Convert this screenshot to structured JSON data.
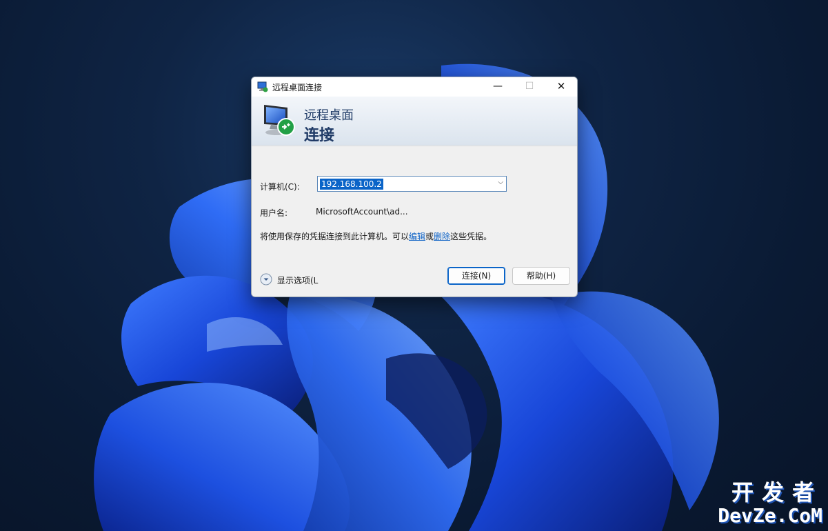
{
  "window": {
    "title": "远程桌面连接",
    "minimize_glyph": "—",
    "maximize_glyph": "☐",
    "close_glyph": "✕"
  },
  "banner": {
    "line1": "远程桌面",
    "line2": "连接"
  },
  "form": {
    "computer_label": "计算机(C):",
    "computer_value": "192.168.100.2",
    "username_label": "用户名:",
    "username_value": "MicrosoftAccount\\ad...",
    "info_prefix": "将使用保存的凭据连接到此计算机。可以",
    "info_edit_link": "编辑",
    "info_or": "或",
    "info_delete_link": "删除",
    "info_suffix": "这些凭据。"
  },
  "footer": {
    "show_options_label": "显示选项(L",
    "connect_button": "连接(N)",
    "help_button": "帮助(H)"
  },
  "watermark": {
    "cn": "开发者",
    "en": "DevZe.CoM"
  },
  "colors": {
    "accent": "#0a64c8",
    "banner_text": "#1f3a66",
    "link": "#0f63c6"
  }
}
